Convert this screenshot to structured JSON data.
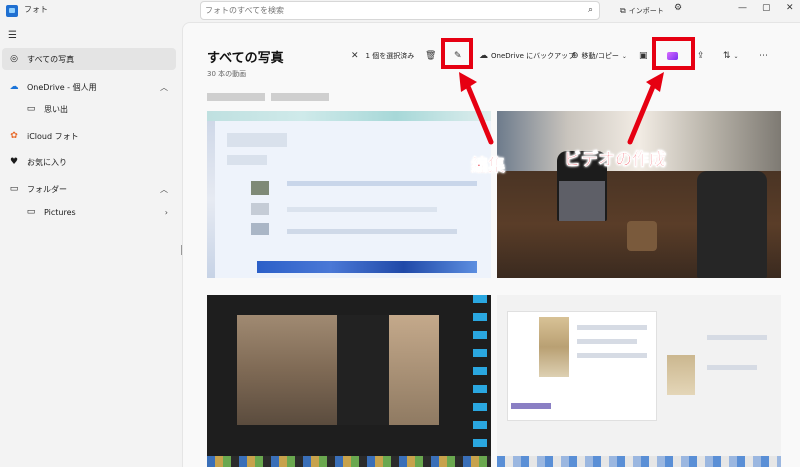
{
  "window": {
    "title": "フォト",
    "buttons": [
      "minimize-icon",
      "maximize-icon",
      "close-icon"
    ]
  },
  "search": {
    "placeholder": "フォトのすべてを検索"
  },
  "header": {
    "import_label": "インポート"
  },
  "sidebar": {
    "items": [
      {
        "label": "すべての写真",
        "icon": "photos-icon",
        "active": true
      },
      {
        "label": "OneDrive - 個人用",
        "icon": "onedrive-icon",
        "expanded": true
      },
      {
        "label": "思い出",
        "icon": "memories-icon",
        "sub": true
      },
      {
        "label": "iCloud フォト",
        "icon": "icloud-icon"
      },
      {
        "label": "お気に入り",
        "icon": "heart-icon"
      },
      {
        "label": "フォルダー",
        "icon": "folder-icon",
        "expanded": true
      },
      {
        "label": "Pictures",
        "icon": "folder-icon",
        "sub": true
      }
    ]
  },
  "main": {
    "title": "すべての写真",
    "subtitle": "30 本の動画",
    "toolbar": {
      "selected_label": "1 個を選択済み",
      "onedrive_backup_label": "OneDrive にバックアップ",
      "move_copy_label": "移動/コピー"
    }
  },
  "annotations": {
    "edit_label": "編集",
    "create_video_label": "ビデオの作成",
    "color": "#e60012"
  }
}
